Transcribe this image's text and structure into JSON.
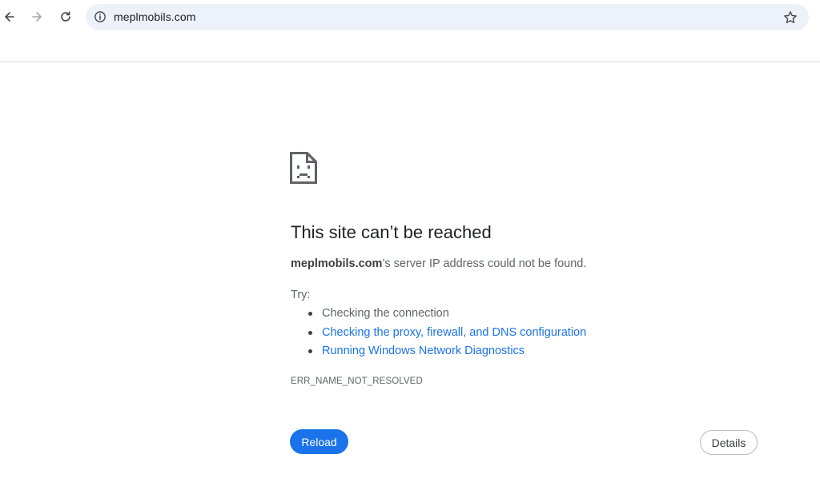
{
  "browser": {
    "address_bar": {
      "url": "meplmobils.com"
    },
    "icons": {
      "back": "back-arrow-icon",
      "forward": "forward-arrow-icon",
      "reload": "reload-icon",
      "site_info": "info-icon",
      "bookmark": "star-icon"
    }
  },
  "error_page": {
    "icon": "sad-document-icon",
    "title": "This site can’t be reached",
    "summary_domain": "meplmobils.com",
    "summary_text": "’s server IP address could not be found.",
    "try_label": "Try:",
    "suggestions": [
      {
        "label": "Checking the connection",
        "is_link": false
      },
      {
        "label": "Checking the proxy, firewall, and DNS configuration",
        "is_link": true
      },
      {
        "label": "Running Windows Network Diagnostics",
        "is_link": true
      }
    ],
    "error_code": "ERR_NAME_NOT_RESOLVED",
    "reload_label": "Reload",
    "details_label": "Details"
  },
  "colors": {
    "link": "#1a73e8",
    "primary_button": "#1a73e8",
    "text_secondary": "#5f6368",
    "omnibox_bg": "#edf1f9"
  }
}
